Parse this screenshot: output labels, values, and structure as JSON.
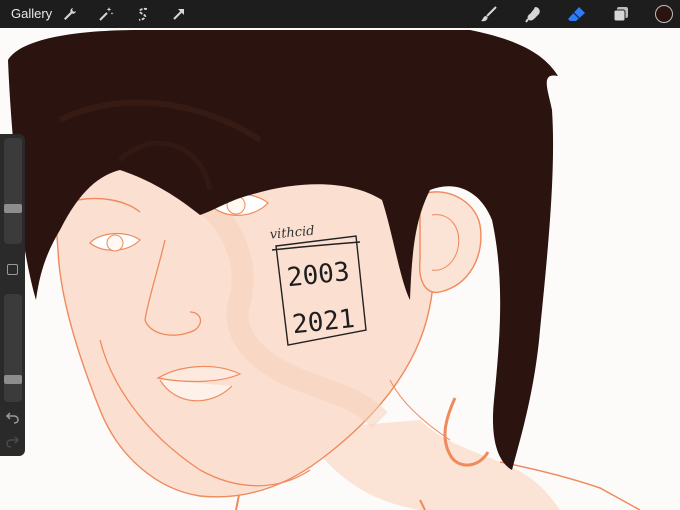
{
  "app": {
    "gallery_label": "Gallery"
  },
  "toolbar": {
    "left_tools": [
      "wrench-icon",
      "magic-wand-icon",
      "selection-icon",
      "transform-arrow-icon"
    ],
    "right_tools": [
      "brush-icon",
      "smudge-icon",
      "eraser-icon",
      "layers-icon"
    ],
    "active_tool": "eraser-icon",
    "accent_color": "#2f7bf5",
    "current_color": "#2b140f"
  },
  "sidebar": {
    "brush_size_level": 0.32,
    "opacity_level": 0.18,
    "undo_icon": "undo-icon",
    "redo_icon": "redo-icon"
  },
  "artwork": {
    "stamp_top": "2003",
    "stamp_bottom": "2021",
    "signature": "vithcid"
  },
  "colors": {
    "hair": "#2b140f",
    "skin": "#fbe0d2",
    "sketch": "#ef8a5c",
    "background": "#fdfbf9"
  }
}
